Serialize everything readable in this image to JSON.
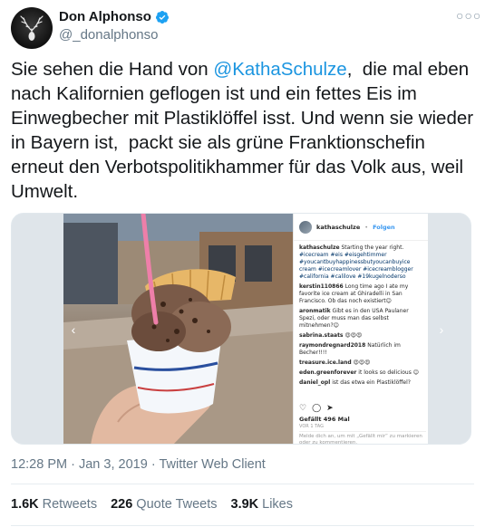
{
  "author": {
    "display_name": "Don Alphonso",
    "handle": "@_donalphonso",
    "verified": true,
    "avatar_icon": "deer-antler-icon"
  },
  "tweet": {
    "text_before_mention": "Sie sehen die Hand von ",
    "mention": "@KathaSchulze",
    "text_after_mention": ",  die mal eben nach Kalifornien geflogen ist und ein fettes Eis im  Einwegbecher mit Plastiklöffel isst. Und wenn sie wieder in Bayern ist,  packt sie als grüne Franktionschefin erneut den Verbotspolitikhammer für das Volk aus, weil Umwelt."
  },
  "media": {
    "instagram": {
      "username": "kathaschulze",
      "follow_label": "Folgen",
      "caption_user": "kathaschulze",
      "caption": "Starting the year right.",
      "caption_tags": "#icecream #eis #eisgehtimmer #youcantbuyhappinessbutyoucanbuyice cream #icecreamlover #icecreamblogger #california #calilove #19kugelnoderso",
      "comments": [
        {
          "user": "kerstin110866",
          "text": "Long time ago I ate my favorite ice cream at Ghiradelli in San Francisco. Ob das noch existiert😊"
        },
        {
          "user": "aronmatik",
          "text": "Gibt es in den USA Paulaner Spezi, oder muss man das selbst mitnehmen?😊"
        },
        {
          "user": "sabrina.staats",
          "text": "😍😍😍"
        },
        {
          "user": "raymondregnard2018",
          "text": "Natürlich im Becher!!!!"
        },
        {
          "user": "treasure.ice.land",
          "text": "😍😍😍"
        },
        {
          "user": "eden.greenforever",
          "text": "it looks so delicious 😊"
        },
        {
          "user": "daniel_opl",
          "text": "ist das etwa ein Plastiklöffel?"
        }
      ],
      "likes": "Gefällt 496 Mal",
      "date": "VOR 1 TAG",
      "login_prompt": "Melde dich an, um mit „Gefällt mir“ zu markieren oder zu kommentieren."
    }
  },
  "meta": {
    "time": "12:28 PM",
    "separator": "·",
    "date": "Jan 3, 2019",
    "client": "Twitter Web Client"
  },
  "stats": {
    "retweets_count": "1.6K",
    "retweets_label": "Retweets",
    "quotes_count": "226",
    "quotes_label": "Quote Tweets",
    "likes_count": "3.9K",
    "likes_label": "Likes"
  }
}
